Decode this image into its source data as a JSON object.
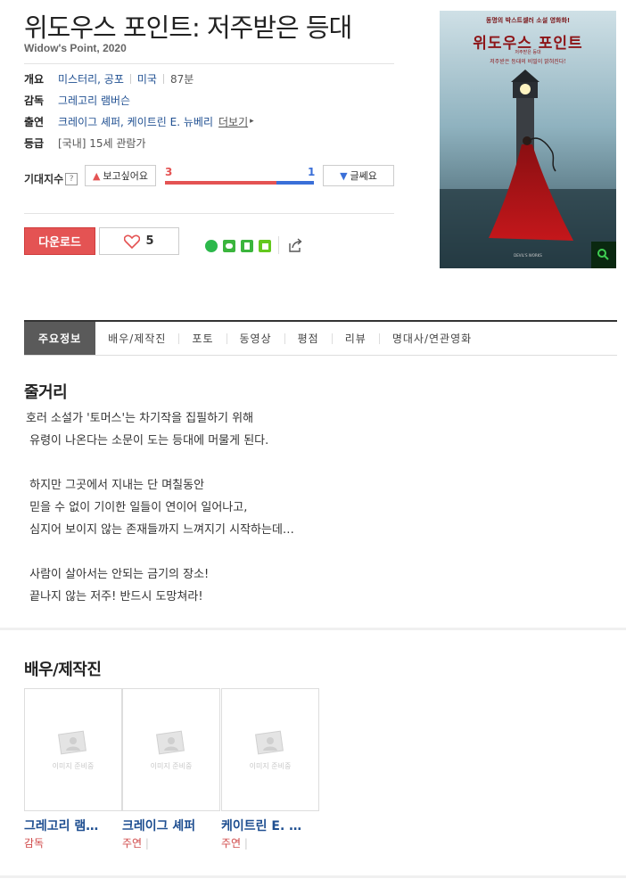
{
  "movie": {
    "title": "위도우스 포인트: 저주받은 등대",
    "subtitle": "Widow's Point, 2020"
  },
  "info": {
    "overview_label": "개요",
    "genre": "미스터리, 공포",
    "country": "미국",
    "runtime": "87분",
    "director_label": "감독",
    "director": "그레고리 램버슨",
    "cast_label": "출연",
    "cast": "크레이그 셰퍼, 케이트린 E. 뉴베리",
    "more": "더보기",
    "rating_label": "등급",
    "rating": "[국내] 15세 관람가"
  },
  "expectation": {
    "label": "기대지수",
    "help": "?",
    "want_label": "보고싶어요",
    "want_count": "3",
    "not_count": "1",
    "not_label": "글쎄요",
    "want_ratio": 0.75,
    "colors": {
      "want": "#e45353",
      "not": "#3a6fd8"
    }
  },
  "actions": {
    "download_label": "다운로드",
    "like_count": "5"
  },
  "share_icons": [
    "line-share-icon",
    "kakaotalk-share-icon",
    "kakaostory-share-icon",
    "band-share-icon",
    "share-icon"
  ],
  "poster": {
    "tagline_top": "동명의 박스트셀러 소설 영화화!",
    "title": "위도우스 포인트",
    "small_title": "저주받은 등대",
    "tagline": "저주받은 등대의 비밀이 밝혀진다!",
    "studio": "DEVIL'S WORKS"
  },
  "tabs": [
    "주요정보",
    "배우/제작진",
    "포토",
    "동영상",
    "평점",
    "리뷰",
    "명대사/연관영화"
  ],
  "synopsis": {
    "heading": "줄거리",
    "text": "호러 소설가 '토머스'는 차기작을 집필하기 위해\n 유령이 나온다는 소문이 도는 등대에 머물게 된다.\n\n 하지만 그곳에서 지내는 단 며칠동안\n 믿을 수 없이 기이한 일들이 연이어 일어나고,\n 심지어 보이지 않는 존재들까지 느껴지기 시작하는데…\n\n 사람이 살아서는 안되는 금기의 장소!\n 끝나지 않는 저주! 반드시 도망쳐라!"
  },
  "crew": {
    "heading": "배우/제작진",
    "no_image": "이미지 준비중",
    "people": [
      {
        "name": "그레고리 램…",
        "role": "감독"
      },
      {
        "name": "크레이그 셰퍼",
        "role": "주연"
      },
      {
        "name": "케이트린 E. …",
        "role": "주연"
      }
    ]
  }
}
